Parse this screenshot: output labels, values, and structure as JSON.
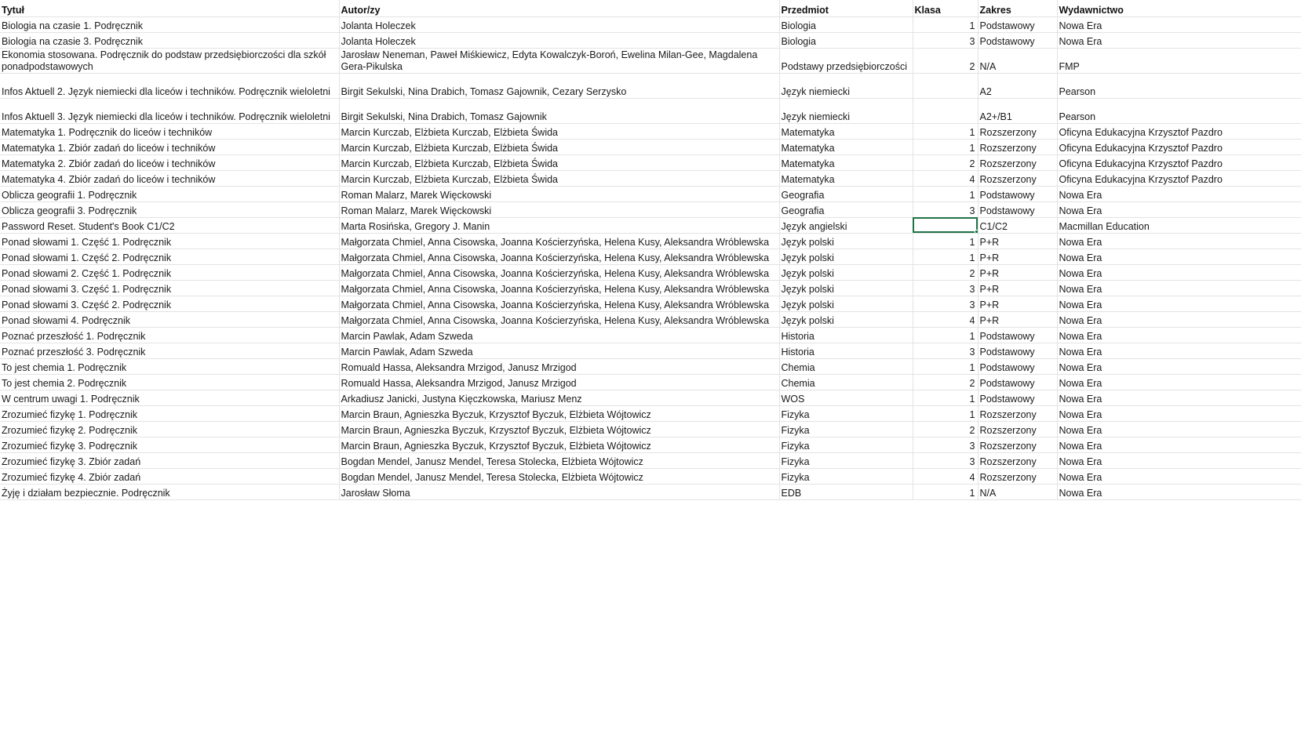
{
  "columns": [
    "Tytuł",
    "Autor/zy",
    "Przedmiot",
    "Klasa",
    "Zakres",
    "Wydawnictwo"
  ],
  "rows": [
    {
      "title": "Biologia na czasie 1. Podręcznik",
      "authors": "Jolanta Holeczek",
      "subject": "Biologia",
      "grade": "1",
      "scope": "Podstawowy",
      "publisher": "Nowa Era"
    },
    {
      "title": "Biologia na czasie 3. Podręcznik",
      "authors": "Jolanta Holeczek",
      "subject": "Biologia",
      "grade": "3",
      "scope": "Podstawowy",
      "publisher": "Nowa Era"
    },
    {
      "title": "Ekonomia stosowana. Podręcznik do podstaw przedsiębiorczości dla szkół ponadpodstawowych",
      "authors": "Jarosław Neneman, Paweł Miśkiewicz, Edyta Kowalczyk-Boroń, Ewelina Milan-Gee, Magdalena Gera-Pikulska",
      "subject": "Podstawy przedsiębiorczości",
      "grade": "2",
      "scope": "N/A",
      "publisher": "FMP"
    },
    {
      "title": "Infos Aktuell 2. Język niemiecki dla liceów i techników. Podręcznik wieloletni",
      "authors": "Birgit Sekulski, Nina Drabich, Tomasz Gajownik, Cezary Serzysko",
      "subject": "Język niemiecki",
      "grade": "",
      "scope": "A2",
      "publisher": "Pearson"
    },
    {
      "title": "Infos Aktuell 3. Język niemiecki dla liceów i techników. Podręcznik wieloletni",
      "authors": "Birgit Sekulski, Nina Drabich, Tomasz Gajownik",
      "subject": "Język niemiecki",
      "grade": "",
      "scope": "A2+/B1",
      "publisher": "Pearson"
    },
    {
      "title": "Matematyka 1. Podręcznik do liceów i techników",
      "authors": "Marcin Kurczab, Elżbieta Kurczab, Elżbieta Świda",
      "subject": "Matematyka",
      "grade": "1",
      "scope": "Rozszerzony",
      "publisher": "Oficyna Edukacyjna Krzysztof Pazdro"
    },
    {
      "title": "Matematyka 1. Zbiór zadań do liceów i techników",
      "authors": "Marcin Kurczab, Elżbieta Kurczab, Elżbieta Świda",
      "subject": "Matematyka",
      "grade": "1",
      "scope": "Rozszerzony",
      "publisher": "Oficyna Edukacyjna Krzysztof Pazdro"
    },
    {
      "title": "Matematyka 2. Zbiór zadań do liceów i techników",
      "authors": "Marcin Kurczab, Elżbieta Kurczab, Elżbieta Świda",
      "subject": "Matematyka",
      "grade": "2",
      "scope": "Rozszerzony",
      "publisher": "Oficyna Edukacyjna Krzysztof Pazdro"
    },
    {
      "title": "Matematyka 4. Zbiór zadań do liceów i techników",
      "authors": "Marcin Kurczab, Elżbieta Kurczab, Elżbieta Świda",
      "subject": "Matematyka",
      "grade": "4",
      "scope": "Rozszerzony",
      "publisher": "Oficyna Edukacyjna Krzysztof Pazdro"
    },
    {
      "title": "Oblicza geografii 1. Podręcznik",
      "authors": "Roman Malarz, Marek Więckowski",
      "subject": "Geografia",
      "grade": "1",
      "scope": "Podstawowy",
      "publisher": "Nowa Era"
    },
    {
      "title": "Oblicza geografii 3. Podręcznik",
      "authors": "Roman Malarz, Marek Więckowski",
      "subject": "Geografia",
      "grade": "3",
      "scope": "Podstawowy",
      "publisher": "Nowa Era"
    },
    {
      "title": "Password Reset. Student's Book C1/C2",
      "authors": "Marta Rosińska, Gregory J. Manin",
      "subject": "Język angielski",
      "grade": "",
      "scope": "C1/C2",
      "publisher": "Macmillan Education"
    },
    {
      "title": "Ponad słowami 1. Część 1. Podręcznik",
      "authors": "Małgorzata Chmiel, Anna Cisowska, Joanna Kościerzyńska, Helena Kusy, Aleksandra Wróblewska",
      "subject": "Język polski",
      "grade": "1",
      "scope": "P+R",
      "publisher": "Nowa Era"
    },
    {
      "title": "Ponad słowami 1. Część 2. Podręcznik",
      "authors": "Małgorzata Chmiel, Anna Cisowska, Joanna Kościerzyńska, Helena Kusy, Aleksandra Wróblewska",
      "subject": "Język polski",
      "grade": "1",
      "scope": "P+R",
      "publisher": "Nowa Era"
    },
    {
      "title": "Ponad słowami 2. Część 1. Podręcznik",
      "authors": "Małgorzata Chmiel, Anna Cisowska, Joanna Kościerzyńska, Helena Kusy, Aleksandra Wróblewska",
      "subject": "Język polski",
      "grade": "2",
      "scope": "P+R",
      "publisher": "Nowa Era"
    },
    {
      "title": "Ponad słowami 3. Część 1. Podręcznik",
      "authors": "Małgorzata Chmiel, Anna Cisowska, Joanna Kościerzyńska, Helena Kusy, Aleksandra Wróblewska",
      "subject": "Język polski",
      "grade": "3",
      "scope": "P+R",
      "publisher": "Nowa Era"
    },
    {
      "title": "Ponad słowami 3. Część 2. Podręcznik",
      "authors": "Małgorzata Chmiel, Anna Cisowska, Joanna Kościerzyńska, Helena Kusy, Aleksandra Wróblewska",
      "subject": "Język polski",
      "grade": "3",
      "scope": "P+R",
      "publisher": "Nowa Era"
    },
    {
      "title": "Ponad słowami 4. Podręcznik",
      "authors": "Małgorzata Chmiel, Anna Cisowska, Joanna Kościerzyńska, Helena Kusy, Aleksandra Wróblewska",
      "subject": "Język polski",
      "grade": "4",
      "scope": "P+R",
      "publisher": "Nowa Era"
    },
    {
      "title": "Poznać przeszłość 1. Podręcznik",
      "authors": "Marcin Pawlak, Adam Szweda",
      "subject": "Historia",
      "grade": "1",
      "scope": "Podstawowy",
      "publisher": "Nowa Era"
    },
    {
      "title": "Poznać przeszłość 3. Podręcznik",
      "authors": "Marcin Pawlak, Adam Szweda",
      "subject": "Historia",
      "grade": "3",
      "scope": "Podstawowy",
      "publisher": "Nowa Era"
    },
    {
      "title": "To jest chemia 1. Podręcznik",
      "authors": "Romuald Hassa, Aleksandra Mrzigod, Janusz Mrzigod",
      "subject": "Chemia",
      "grade": "1",
      "scope": "Podstawowy",
      "publisher": "Nowa Era"
    },
    {
      "title": "To jest chemia 2. Podręcznik",
      "authors": "Romuald Hassa, Aleksandra Mrzigod, Janusz Mrzigod",
      "subject": "Chemia",
      "grade": "2",
      "scope": "Podstawowy",
      "publisher": "Nowa Era"
    },
    {
      "title": "W centrum uwagi 1. Podręcznik",
      "authors": "Arkadiusz Janicki, Justyna Kięczkowska, Mariusz Menz",
      "subject": "WOS",
      "grade": "1",
      "scope": "Podstawowy",
      "publisher": "Nowa Era"
    },
    {
      "title": "Zrozumieć fizykę 1. Podręcznik",
      "authors": "Marcin Braun, Agnieszka Byczuk, Krzysztof Byczuk, Elżbieta Wójtowicz",
      "subject": "Fizyka",
      "grade": "1",
      "scope": "Rozszerzony",
      "publisher": "Nowa Era"
    },
    {
      "title": "Zrozumieć fizykę 2. Podręcznik",
      "authors": "Marcin Braun, Agnieszka Byczuk, Krzysztof Byczuk, Elżbieta Wójtowicz",
      "subject": "Fizyka",
      "grade": "2",
      "scope": "Rozszerzony",
      "publisher": "Nowa Era"
    },
    {
      "title": "Zrozumieć fizykę 3. Podręcznik",
      "authors": "Marcin Braun, Agnieszka Byczuk, Krzysztof Byczuk, Elżbieta Wójtowicz",
      "subject": "Fizyka",
      "grade": "3",
      "scope": "Rozszerzony",
      "publisher": "Nowa Era"
    },
    {
      "title": "Zrozumieć fizykę 3. Zbiór zadań",
      "authors": "Bogdan Mendel, Janusz Mendel, Teresa Stolecka, Elżbieta Wójtowicz",
      "subject": "Fizyka",
      "grade": "3",
      "scope": "Rozszerzony",
      "publisher": "Nowa Era"
    },
    {
      "title": "Zrozumieć fizykę 4. Zbiór zadań",
      "authors": "Bogdan Mendel, Janusz Mendel, Teresa Stolecka, Elżbieta Wójtowicz",
      "subject": "Fizyka",
      "grade": "4",
      "scope": "Rozszerzony",
      "publisher": "Nowa Era"
    },
    {
      "title": "Żyję i działam bezpiecznie. Podręcznik",
      "authors": "Jarosław Słoma",
      "subject": "EDB",
      "grade": "1",
      "scope": "N/A",
      "publisher": "Nowa Era"
    }
  ],
  "selection": {
    "row": 11,
    "column": 3
  },
  "colors": {
    "gridline": "#e3e3e3",
    "selection": "#217346"
  }
}
